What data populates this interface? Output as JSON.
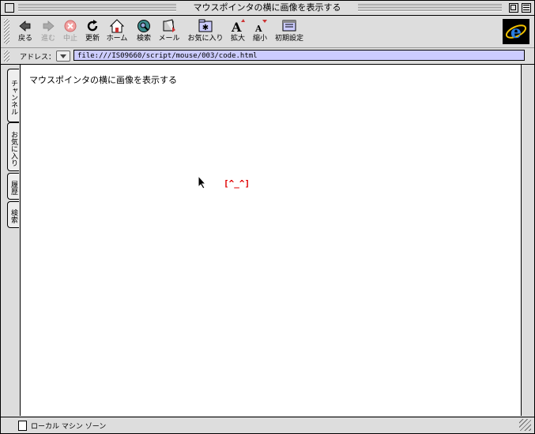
{
  "window": {
    "title": "マウスポインタの横に画像を表示する"
  },
  "toolbar": {
    "items": [
      {
        "label": "戻る",
        "icon": "back-arrow-icon"
      },
      {
        "label": "進む",
        "icon": "forward-arrow-icon"
      },
      {
        "label": "中止",
        "icon": "stop-icon"
      },
      {
        "label": "更新",
        "icon": "refresh-icon"
      },
      {
        "label": "ホーム",
        "icon": "home-icon"
      },
      {
        "label": "検索",
        "icon": "search-icon"
      },
      {
        "label": "メール",
        "icon": "mail-icon"
      },
      {
        "label": "お気に入り",
        "icon": "favorites-icon"
      },
      {
        "label": "拡大",
        "icon": "text-larger-icon"
      },
      {
        "label": "縮小",
        "icon": "text-smaller-icon"
      },
      {
        "label": "初期設定",
        "icon": "preferences-icon"
      }
    ]
  },
  "address": {
    "label": "アドレス：",
    "url": "file:///IS09660/script/mouse/003/code.html"
  },
  "sidetabs": [
    "チャンネル",
    "お気に入り",
    "履歴",
    "検索"
  ],
  "content": {
    "text": "マウスポインタの横に画像を表示する",
    "face": "[^_^]"
  },
  "status": {
    "zone": "ローカル マシン ゾーン"
  },
  "colors": {
    "address_bg": "#ccccff",
    "face": "#e00000",
    "chrome": "#dddddd"
  }
}
